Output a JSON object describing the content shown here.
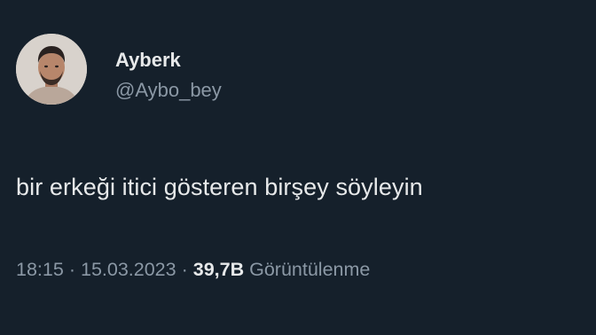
{
  "author": {
    "display_name": "Ayberk",
    "handle": "@Aybo_bey"
  },
  "tweet": {
    "text": "bir erkeği itici gösteren birşey söyleyin"
  },
  "meta": {
    "time": "18:15",
    "separator": "·",
    "date": "15.03.2023",
    "views_count": "39,7B",
    "views_label": "Görüntülenme"
  },
  "colors": {
    "background": "#15202b",
    "primary_text": "#e7e9ea",
    "secondary_text": "#8b98a5"
  }
}
